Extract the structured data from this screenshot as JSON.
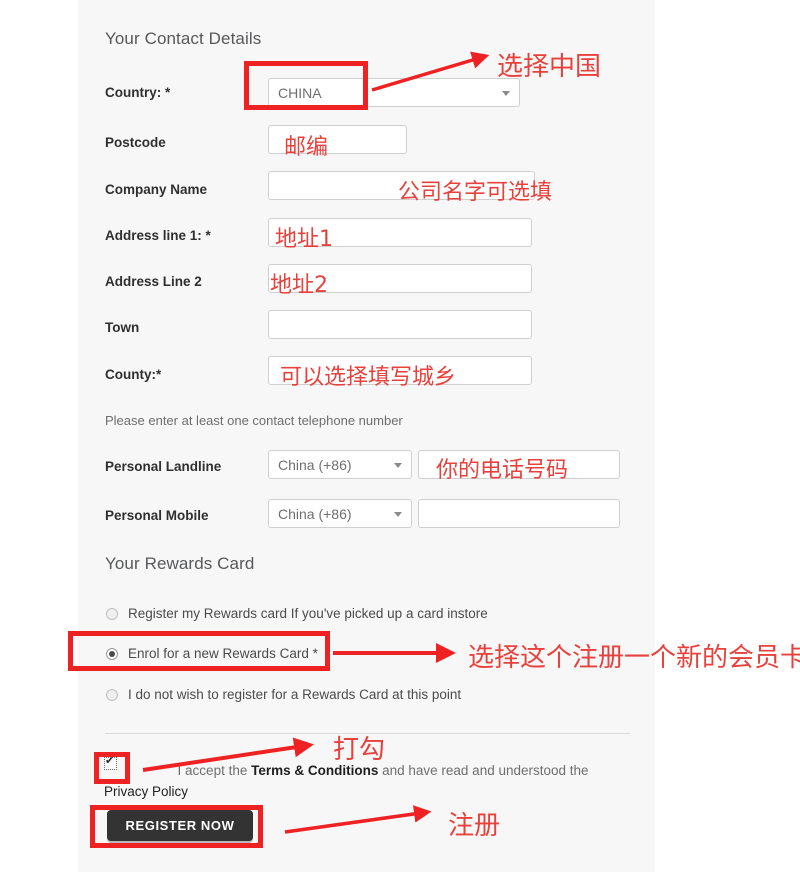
{
  "page": {
    "background": "#ffffff",
    "panel_background": "#f7f7f7",
    "annotation_color": "#e8413c"
  },
  "sections": {
    "contact_details_title": "Your Contact Details",
    "rewards_title": "Your Rewards Card"
  },
  "fields": [
    {
      "label": "Country: *",
      "type": "select",
      "value": "CHINA",
      "placeholder": ""
    },
    {
      "label": "Postcode",
      "type": "text",
      "value": "",
      "placeholder": ""
    },
    {
      "label": "Company Name",
      "type": "text",
      "value": "",
      "placeholder": ""
    },
    {
      "label": "Address line 1: *",
      "type": "text",
      "value": "",
      "placeholder": ""
    },
    {
      "label": "Address Line 2",
      "type": "text",
      "value": "",
      "placeholder": ""
    },
    {
      "label": "Town",
      "type": "text",
      "value": "",
      "placeholder": ""
    },
    {
      "label": "County:*",
      "type": "text",
      "value": "",
      "placeholder": ""
    }
  ],
  "phone": {
    "helper": "Please enter at least one contact telephone number",
    "rows": [
      {
        "label": "Personal Landline",
        "country_code": "China (+86)",
        "number": ""
      },
      {
        "label": "Personal Mobile",
        "country_code": "China (+86)",
        "number": ""
      }
    ]
  },
  "rewards_options": [
    {
      "label": "Register my Rewards card  If you've picked up a card instore",
      "selected": false
    },
    {
      "label": "Enrol for a new Rewards Card *",
      "selected": true
    },
    {
      "label": "I do not wish to register for a Rewards Card at this point",
      "selected": false
    }
  ],
  "terms": {
    "checked": true,
    "prefix": "I accept the ",
    "link1": "Terms & Conditions",
    "middle": " and have read and understood the ",
    "link2": "Privacy Policy"
  },
  "register_button": {
    "label": "REGISTER NOW"
  },
  "annotations": [
    {
      "name": "select-china",
      "text": "选择中国"
    },
    {
      "name": "postcode",
      "text": "邮编"
    },
    {
      "name": "company-optional",
      "text": "公司名字可选填"
    },
    {
      "name": "address-1",
      "text": "地址1"
    },
    {
      "name": "address-2",
      "text": "地址2"
    },
    {
      "name": "county-optional",
      "text": "可以选择填写城乡"
    },
    {
      "name": "phone-number",
      "text": "你的电话号码"
    },
    {
      "name": "choose-new-card",
      "text": "选择这个注册一个新的会员卡"
    },
    {
      "name": "tick-checkbox",
      "text": "打勾"
    },
    {
      "name": "register",
      "text": "注册"
    }
  ]
}
